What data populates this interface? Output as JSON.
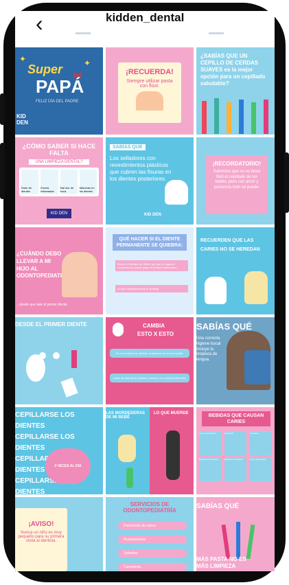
{
  "header": {
    "title": "kidden_dental",
    "back_icon": "chevron-left-icon"
  },
  "posts": [
    {
      "id": "super-papa",
      "l1": "Super",
      "l2": "PAPÁ",
      "sub": "FELIZ DÍA DEL PADRE",
      "brand": "KID DEN"
    },
    {
      "id": "recuerda",
      "title": "¡RECUERDA!",
      "text": "Siempre utilizar pasta con flúor."
    },
    {
      "id": "sabias-cepillo",
      "text": "¿SABÍAS QUE UN CEPILLO DE CERDAS SUAVES es la mejor opción para un cepillado saludable?"
    },
    {
      "id": "como-saber",
      "title": "¿CÓMO SABER SI HACE FALTA",
      "sub": "UNA LIMPIEZA DENTAL?",
      "cards": [
        "Dolor de dientes",
        "Encías inflamadas",
        "Mal olor de boca",
        "Manchas en los dientes"
      ],
      "brand": "KID DEN"
    },
    {
      "id": "sabias-selladores",
      "tag": "SABÍAS QUE",
      "text": "Los selladores con revestimientos plásticos que cubren las fisuras en los dientes posteriores.",
      "brand": "KID DEN"
    },
    {
      "id": "recordatorio",
      "title": "¡RECORDATORIO!",
      "text": "Sabemos que no es tarea fácil el cepillado de los bebés, pero con amor y paciencia todo se puede."
    },
    {
      "id": "cuando-debo",
      "text": "¿CUÁNDO DEBO LLEVAR A MI HIJO AL ODONTOPEDIATRA?",
      "foot": "...desde que sale el primer diente"
    },
    {
      "id": "que-hacer",
      "title": "QUÉ HACER SI EL DIENTE PERMANENTE SE QUIEBRA:",
      "s1": "Buscar el pedazo de diente (ya que en algunos ocasiones se puede pegar el pedazo fracturado)",
      "s2": "Acudir inmediatamente al dentista"
    },
    {
      "id": "recuerden",
      "text": "RECUERDEN QUE LAS CARIES NO SE HEREDAN"
    },
    {
      "id": "desde-primer",
      "text": "DESDE EL PRIMER DIENTE"
    },
    {
      "id": "cambia",
      "t1": "CAMBIA",
      "t2": "ESTO X ESTO",
      "b1": "Si no te tomas los dientes, la limpieza no se va a quitar.",
      "b2": "Lavar los dientes en familia y hacerlo un momento divertido."
    },
    {
      "id": "sabias-foto",
      "tag": "SABÍAS QUÉ",
      "text": "Una correcta higiene bucal incluye la limpieza de lengua."
    },
    {
      "id": "cepillarse",
      "line": "CEPILLARSE LOS DIENTES",
      "badge": "3 VECES AL DÍA"
    },
    {
      "id": "mordederas",
      "left": "LAS MORDEDERAS DE MI BEBÉ",
      "right": "LO QUE MUERDE"
    },
    {
      "id": "bebidas",
      "title": "BEBIDAS QUE CAUSAN CARIES",
      "items": [
        "Jugos procesados",
        "Gaseosas",
        "Té helado",
        "Bebidas azucaradas",
        "Bebidas energéticas",
        "Leche saborizada"
      ]
    },
    {
      "id": "aviso",
      "title": "¡AVISO!",
      "text": "Nunca un niño es muy pequeño para su primera visita al dentista."
    },
    {
      "id": "servicios",
      "title": "SERVICIOS DE ODONTOPEDIATRÍA",
      "items": [
        "Prevención de caries",
        "Fluorizaciones",
        "Sellantes",
        "Curaciones"
      ]
    },
    {
      "id": "sabias-pasta",
      "tag": "SABÍAS QUÉ",
      "text": "MÁS PASTA NO ES MÁS LIMPIEZA"
    }
  ]
}
